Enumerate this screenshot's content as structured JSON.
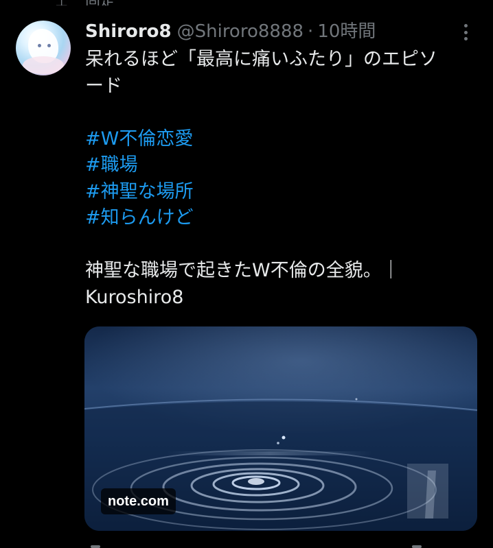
{
  "top": {
    "pinned_label": "固定"
  },
  "tweet": {
    "display_name": "Shiroro8",
    "handle": "@Shiroro8888",
    "separator": "·",
    "time": "10時間",
    "text_lines": [
      "呆れるほど「最高に痛いふたり」のエピソ",
      "ード"
    ],
    "hashtags": [
      "#W不倫恋愛",
      "#職場",
      "#神聖な場所",
      "#知らんけど"
    ],
    "link_text_lines": [
      "神聖な職場で起きたW不倫の全貌。｜",
      "Kuroshiro8"
    ]
  },
  "card": {
    "domain_badge": "note.com",
    "image": "water-ripple-image"
  },
  "colors": {
    "background": "#000000",
    "text": "#e7e9ea",
    "muted": "#71767b",
    "hashtag": "#1d9bf0"
  },
  "icons": {
    "more": "more-vertical-icon",
    "pin": "pin-icon"
  }
}
